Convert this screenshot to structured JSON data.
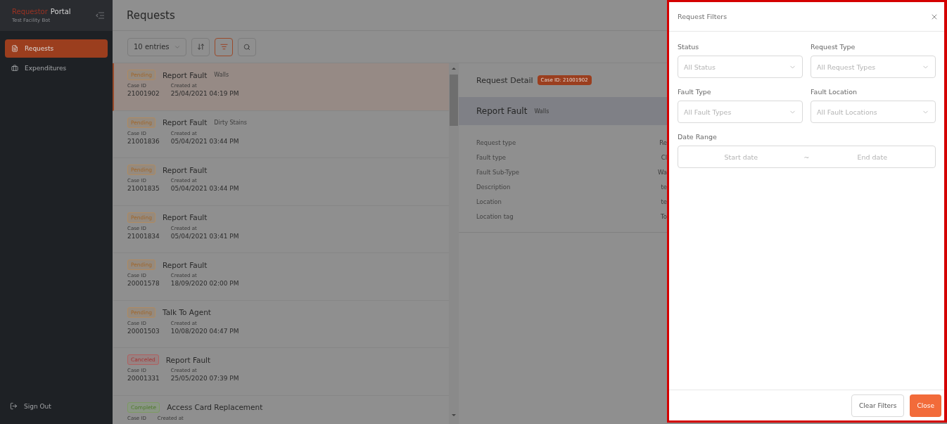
{
  "sidebar": {
    "brand_primary": "Requestor",
    "brand_secondary": "Portal",
    "subtitle": "Test Facility Bot",
    "nav": [
      {
        "label": "Requests",
        "kind": "requests",
        "selected": true
      },
      {
        "label": "Expenditures",
        "kind": "expenditures",
        "selected": false
      }
    ],
    "sign_out": "Sign Out"
  },
  "page": {
    "title": "Requests",
    "entries": "10 entries",
    "tools": [
      {
        "kind": "sort",
        "selected": false
      },
      {
        "kind": "filter",
        "selected": true
      },
      {
        "kind": "search",
        "selected": false
      }
    ]
  },
  "requests": [
    {
      "status": "Pending",
      "kind": "pending",
      "title": "Report Fault",
      "subtitle": "Walls",
      "case_id_label": "Case ID",
      "case_id": "21001902",
      "created_label": "Created at",
      "created_at": "25/04/2021 04:19 PM",
      "selected": true
    },
    {
      "status": "Pending",
      "kind": "pending",
      "title": "Report Fault",
      "subtitle": "Dirty Stains",
      "case_id_label": "Case ID",
      "case_id": "21001836",
      "created_label": "Created at",
      "created_at": "05/04/2021 03:44 PM",
      "selected": false
    },
    {
      "status": "Pending",
      "kind": "pending",
      "title": "Report Fault",
      "case_id_label": "Case ID",
      "case_id": "21001835",
      "created_label": "Created at",
      "created_at": "05/04/2021 03:44 PM",
      "selected": false
    },
    {
      "status": "Pending",
      "kind": "pending",
      "title": "Report Fault",
      "case_id_label": "Case ID",
      "case_id": "21001834",
      "created_label": "Created at",
      "created_at": "05/04/2021 03:41 PM",
      "selected": false
    },
    {
      "status": "Pending",
      "kind": "pending",
      "title": "Report Fault",
      "case_id_label": "Case ID",
      "case_id": "20001578",
      "created_label": "Created at",
      "created_at": "18/09/2020 02:00 PM",
      "selected": false
    },
    {
      "status": "Pending",
      "kind": "pending",
      "title": "Talk To Agent",
      "case_id_label": "Case ID",
      "case_id": "20001503",
      "created_label": "Created at",
      "created_at": "10/08/2020 04:47 PM",
      "selected": false
    },
    {
      "status": "Canceled",
      "kind": "canceled",
      "title": "Report Fault",
      "case_id_label": "Case ID",
      "case_id": "20001331",
      "created_label": "Created at",
      "created_at": "25/05/2020 07:39 PM",
      "selected": false
    },
    {
      "status": "Complete",
      "kind": "complete",
      "title": "Access Card Replacement",
      "case_id_label": "Case ID",
      "created_label": "Created at",
      "selected": false
    }
  ],
  "detail": {
    "title": "Request Detail",
    "case_badge": "Case ID: 21001902",
    "heading": "Report Fault",
    "subheading": "Walls",
    "fields": [
      {
        "label": "Request type",
        "value": "Re"
      },
      {
        "label": "Fault type",
        "value": "Cl"
      },
      {
        "label": "Fault Sub-Type",
        "value": "Wa"
      },
      {
        "label": "Description",
        "value": "te"
      },
      {
        "label": "Location",
        "value": "te"
      },
      {
        "label": "Location tag",
        "value": "To"
      }
    ]
  },
  "filters": {
    "title": "Request Filters",
    "fields": [
      {
        "label": "Status",
        "placeholder": "All Status"
      },
      {
        "label": "Request Type",
        "placeholder": "All Request Types"
      },
      {
        "label": "Fault Type",
        "placeholder": "All Fault Types"
      },
      {
        "label": "Fault Location",
        "placeholder": "All Fault Locations"
      }
    ],
    "date_range": {
      "label": "Date Range",
      "start_placeholder": "Start date",
      "separator": "~",
      "end_placeholder": "End date"
    },
    "clear_button": "Clear Filters",
    "close_button": "Close"
  }
}
